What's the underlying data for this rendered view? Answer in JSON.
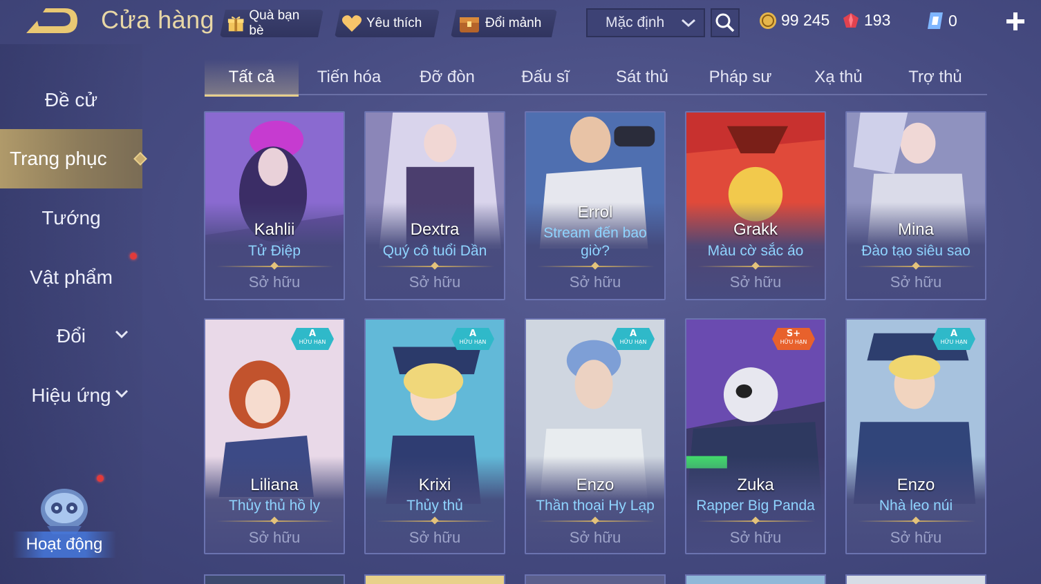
{
  "header": {
    "title": "Cửa hàng",
    "gift_label": "Quà bạn bè",
    "favorite_label": "Yêu thích",
    "shard_label": "Đổi mảnh",
    "sort_value": "Mặc định",
    "gold": "99 245",
    "rubies": "193",
    "vouchers": "0"
  },
  "sidebar": {
    "items": [
      {
        "label": "Đề cử"
      },
      {
        "label": "Trang phục"
      },
      {
        "label": "Tướng"
      },
      {
        "label": "Vật phẩm"
      },
      {
        "label": "Đổi"
      },
      {
        "label": "Hiệu ứng"
      }
    ],
    "event_label": "Hoạt động"
  },
  "tabs": [
    "Tất cả",
    "Tiến hóa",
    "Đỡ đòn",
    "Đấu sĩ",
    "Sát thủ",
    "Pháp sư",
    "Xạ thủ",
    "Trợ thủ"
  ],
  "cards": [
    {
      "hero": "Kahlii",
      "skin": "Tử Điệp",
      "status": "Sở hữu",
      "badge": ""
    },
    {
      "hero": "Dextra",
      "skin": "Quý cô tuổi Dần",
      "status": "Sở hữu",
      "badge": ""
    },
    {
      "hero": "Errol",
      "skin": "Stream đến bao giờ?",
      "status": "Sở hữu",
      "badge": ""
    },
    {
      "hero": "Grakk",
      "skin": "Màu cờ sắc áo",
      "status": "Sở hữu",
      "badge": ""
    },
    {
      "hero": "Mina",
      "skin": "Đào tạo siêu sao",
      "status": "Sở hữu",
      "badge": ""
    },
    {
      "hero": "Liliana",
      "skin": "Thủy thủ hồ ly",
      "status": "Sở hữu",
      "badge": "A",
      "badge_sub": "HỮU HẠN"
    },
    {
      "hero": "Krixi",
      "skin": "Thủy thủ",
      "status": "Sở hữu",
      "badge": "A",
      "badge_sub": "HỮU HẠN"
    },
    {
      "hero": "Enzo",
      "skin": "Thần thoại Hy Lạp",
      "status": "Sở hữu",
      "badge": "A",
      "badge_sub": "HỮU HẠN"
    },
    {
      "hero": "Zuka",
      "skin": "Rapper Big Panda",
      "status": "Sở hữu",
      "badge": "S+",
      "badge_sub": "HỮU HẠN"
    },
    {
      "hero": "Enzo",
      "skin": "Nhà leo núi",
      "status": "Sở hữu",
      "badge": "A",
      "badge_sub": "HỮU HẠN"
    }
  ],
  "colors": {
    "accent_gold": "#e7cf8c",
    "skin_name": "#8fd4ff",
    "badge_a": "#2fb9c9",
    "badge_splus": "#e8612c"
  }
}
